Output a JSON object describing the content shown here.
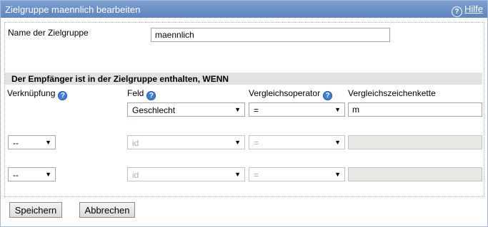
{
  "header": {
    "title": "Zielgruppe maennlich bearbeiten",
    "help_label": "Hilfe"
  },
  "name": {
    "label": "Name der Zielgruppe",
    "value": "maennlich"
  },
  "condition": {
    "heading": "Der Empfänger ist in der Zielgruppe enthalten, WENN",
    "columns": {
      "link": "Verknüpfung",
      "field": "Feld",
      "operator": "Vergleichsoperator",
      "value": "Vergleichszeichenkette"
    },
    "rows": [
      {
        "field": "Geschlecht",
        "operator": "=",
        "value": "m"
      },
      {
        "link": "--",
        "field": "id",
        "operator": "=",
        "value": ""
      },
      {
        "link": "--",
        "field": "id",
        "operator": "=",
        "value": ""
      }
    ]
  },
  "buttons": {
    "save": "Speichern",
    "cancel": "Abbrechen"
  },
  "icons": {
    "help": "help-circle-icon",
    "info": "question-mark-icon",
    "dropdown": "triangle-down-icon"
  },
  "colors": {
    "header_bg": "#6a8fc9",
    "section_bg": "#e2e2e2",
    "info_icon": "#3a7fd8"
  }
}
